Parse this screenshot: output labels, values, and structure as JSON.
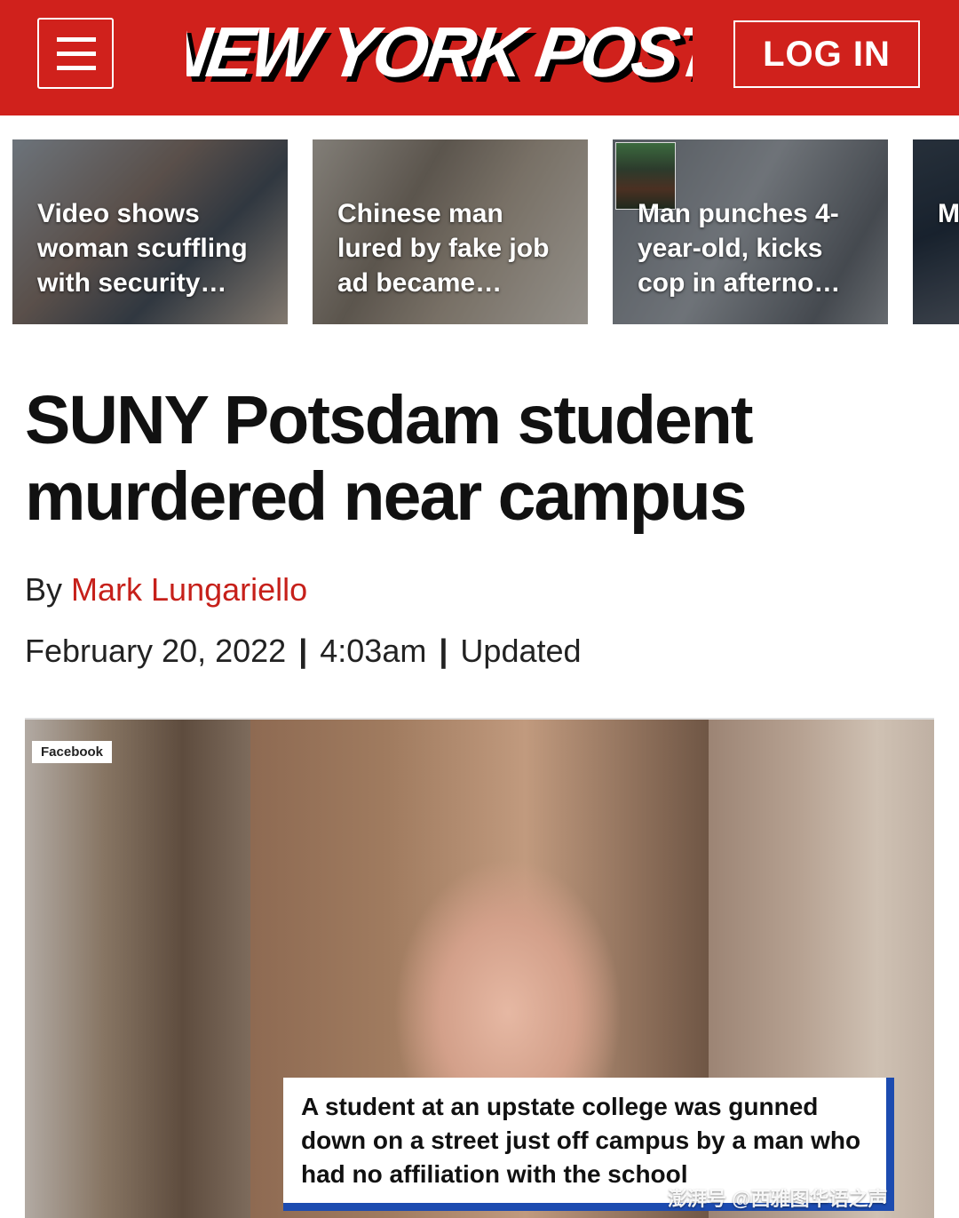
{
  "header": {
    "brand": "NEW YORK POST",
    "login_label": "LOG IN",
    "brand_color": "#d0211c"
  },
  "carousel": [
    {
      "title": "Video shows woman scuffling with security…"
    },
    {
      "title": "Chinese man lured by fake job ad became…"
    },
    {
      "title": "Man punches 4-year-old, kicks cop in afterno…"
    },
    {
      "title": "M ar le"
    }
  ],
  "article": {
    "headline": "SUNY Potsdam student murdered near campus",
    "byline_prefix": "By",
    "author": "Mark Lungariello",
    "date": "February 20, 2022",
    "time": "4:03am",
    "updated": "Updated",
    "photo": {
      "source": "Facebook",
      "caption": "A student at an upstate college was gunned down on a street just off campus by a man who had no affiliation with the school"
    }
  },
  "watermark": "澎湃号 @西雅图华语之声",
  "colors": {
    "accent": "#c6201a",
    "caption_border": "#1c4bb0"
  }
}
